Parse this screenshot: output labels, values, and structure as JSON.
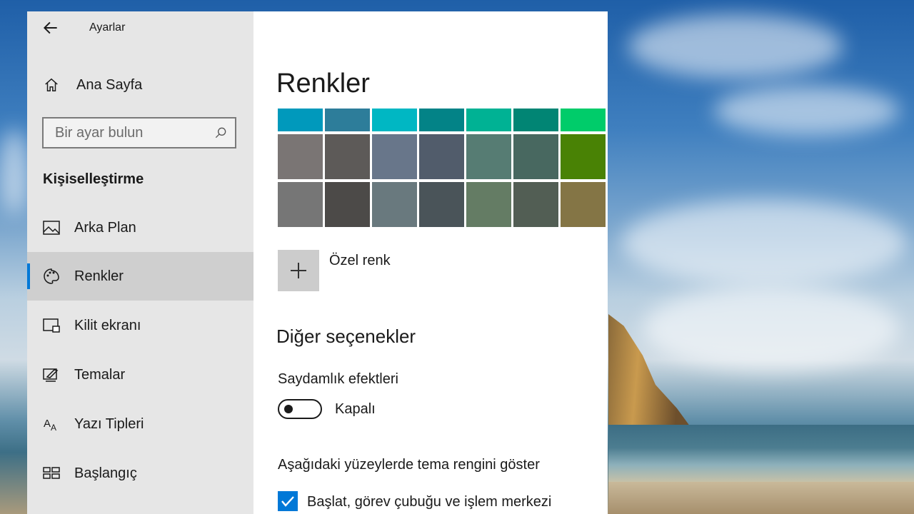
{
  "app": {
    "title": "Ayarlar"
  },
  "sidebar": {
    "home_label": "Ana Sayfa",
    "search_placeholder": "Bir ayar bulun",
    "section_title": "Kişiselleştirme",
    "items": [
      {
        "label": "Arka Plan",
        "icon": "image-icon",
        "selected": false
      },
      {
        "label": "Renkler",
        "icon": "palette-icon",
        "selected": true
      },
      {
        "label": "Kilit ekranı",
        "icon": "lock-screen-icon",
        "selected": false
      },
      {
        "label": "Temalar",
        "icon": "themes-icon",
        "selected": false
      },
      {
        "label": "Yazı Tipleri",
        "icon": "fonts-icon",
        "selected": false
      },
      {
        "label": "Başlangıç",
        "icon": "start-icon",
        "selected": false
      }
    ]
  },
  "main": {
    "title": "Renkler",
    "swatch_rows": [
      [
        "#0099bc",
        "#2d7d9a",
        "#00b7c3",
        "#038387",
        "#00b294",
        "#018574",
        "#00cc6a"
      ],
      [
        "#7a7574",
        "#5d5a58",
        "#68768a",
        "#515c6b",
        "#567c73",
        "#486860",
        "#498205"
      ],
      [
        "#767676",
        "#4c4a48",
        "#69797e",
        "#4a5459",
        "#647c64",
        "#525e54",
        "#847545"
      ]
    ],
    "custom_color_label": "Özel renk",
    "other_options_title": "Diğer seçenekler",
    "transparency": {
      "label": "Saydamlık efektleri",
      "state_text": "Kapalı",
      "on": false
    },
    "surfaces_label": "Aşağıdaki yüzeylerde tema rengini göster",
    "start_taskbar": {
      "label": "Başlat, görev çubuğu ve işlem merkezi",
      "checked": true
    }
  },
  "colors": {
    "accent": "#0078d7"
  }
}
